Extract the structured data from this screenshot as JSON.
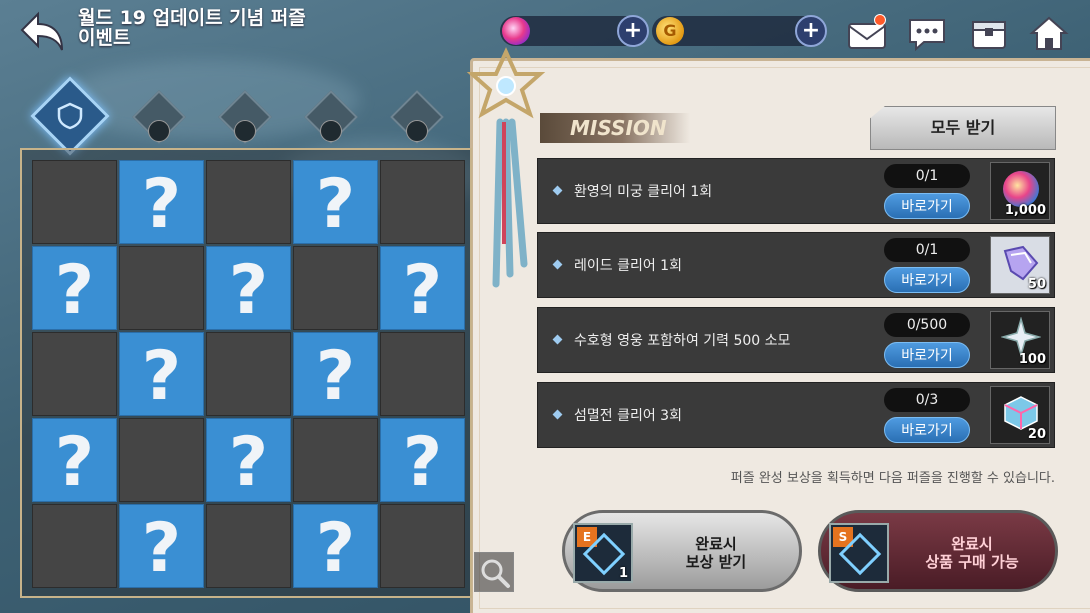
{
  "header": {
    "title": "월드 19 업데이트 기념 퍼즐 이벤트",
    "title_line1": "월드 19 업데이트 기념 퍼즐",
    "title_line2": "이벤트"
  },
  "top_icons": [
    "back-arrow-icon",
    "crystal-currency-icon",
    "gold-currency-icon",
    "mail-icon",
    "chat-icon",
    "inventory-icon",
    "home-icon"
  ],
  "currency": {
    "gold_symbol": "G"
  },
  "puzzle_tabs": [
    {
      "name": "puzzle-1",
      "locked": false,
      "active": true
    },
    {
      "name": "puzzle-2",
      "locked": true
    },
    {
      "name": "puzzle-3",
      "locked": true
    },
    {
      "name": "puzzle-4",
      "locked": true
    },
    {
      "name": "puzzle-5",
      "locked": true
    }
  ],
  "grid": {
    "rows": [
      [
        "dark",
        "blue",
        "dark",
        "blue",
        "dark"
      ],
      [
        "blue",
        "dark",
        "blue",
        "dark",
        "blue"
      ],
      [
        "dark",
        "blue",
        "dark",
        "blue",
        "dark"
      ],
      [
        "blue",
        "dark",
        "blue",
        "dark",
        "blue"
      ],
      [
        "dark",
        "blue",
        "dark",
        "blue",
        "dark"
      ]
    ],
    "hidden_symbol": "?"
  },
  "mission": {
    "label": "MISSION",
    "claim_all": "모두 받기",
    "goto_label": "바로가기",
    "items": [
      {
        "text": "환영의 미궁 클리어 1회",
        "progress": "0/1",
        "reward_qty": "1,000",
        "reward_icon": "crystal-orb-icon"
      },
      {
        "text": "레이드 클리어 1회",
        "progress": "0/1",
        "reward_qty": "50",
        "reward_icon": "crystal-shard-icon"
      },
      {
        "text": "수호형 영웅 포함하여 기력 500 소모",
        "progress": "0/500",
        "reward_qty": "100",
        "reward_icon": "star-shard-icon"
      },
      {
        "text": "섬멸전 클리어 3회",
        "progress": "0/3",
        "reward_qty": "20",
        "reward_icon": "rainbow-cube-icon"
      }
    ]
  },
  "notice": "퍼즐 완성 보상을 획득하면 다음 퍼즐을 진행할 수 있습니다.",
  "bottom_buttons": [
    {
      "grade": "E",
      "qty": "1",
      "label_line1": "완료시",
      "label_line2": "보상 받기"
    },
    {
      "grade": "S",
      "qty": "",
      "label_line1": "완료시",
      "label_line2": "상품 구매 가능"
    }
  ],
  "colors": {
    "blue_cell": "#3a8fd3",
    "dark_cell": "#454545",
    "goto_button": "#3a85d0"
  }
}
